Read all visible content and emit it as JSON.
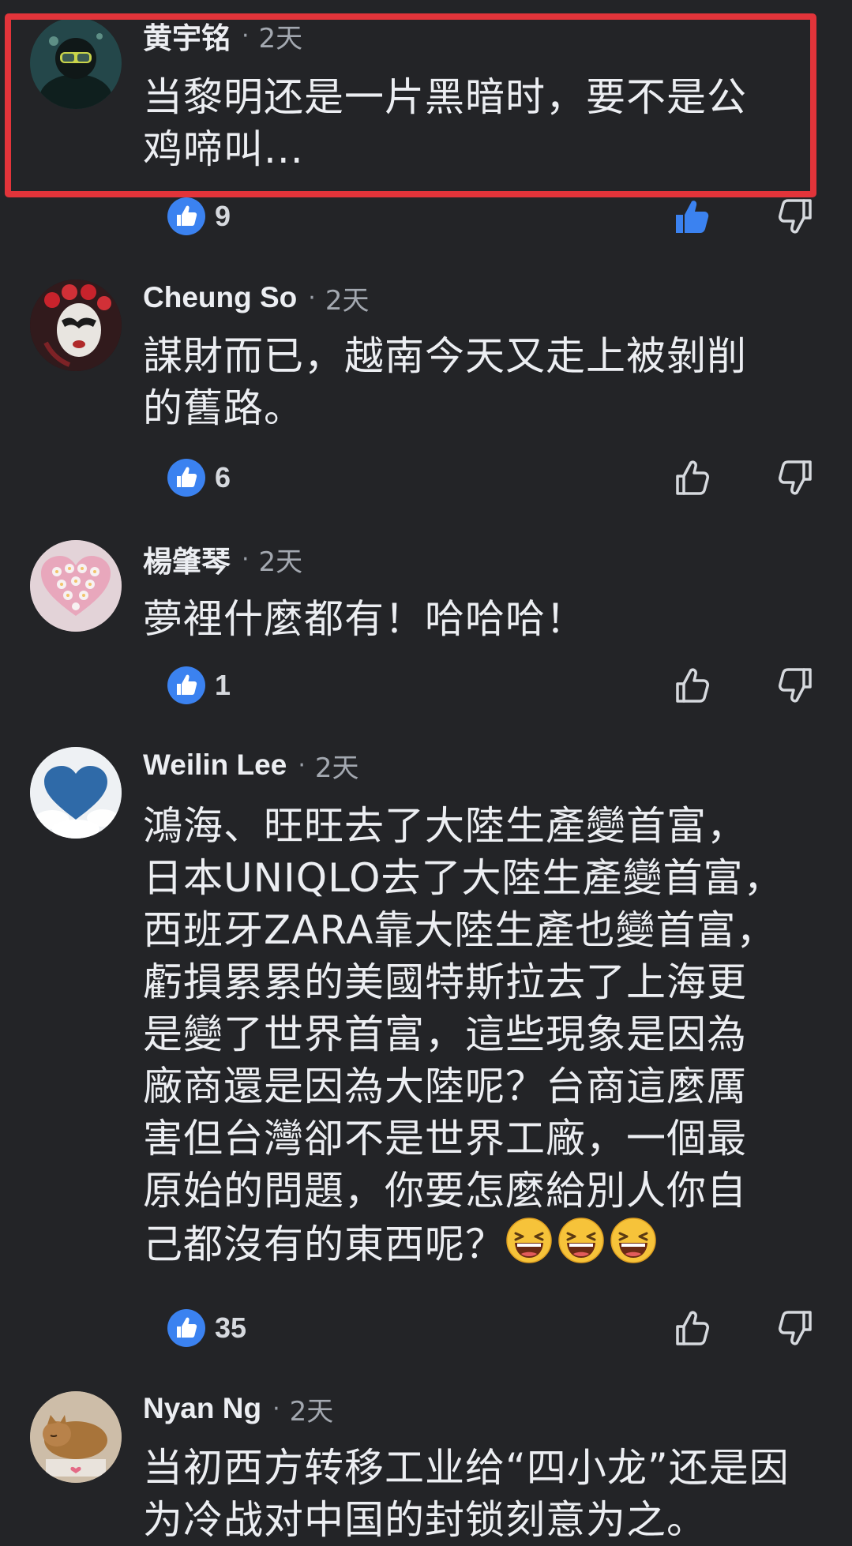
{
  "colors": {
    "background": "#232427",
    "text_primary": "#eceef2",
    "text_secondary": "#a3a8b0",
    "like_badge": "#3b82f0",
    "highlight_border": "#e2343a"
  },
  "comments": [
    {
      "author": "黄宇铭",
      "separator": "·",
      "time": "2天",
      "text": "当黎明还是一片黑暗时，要不是公\n鸡啼叫...",
      "likes": "9",
      "liked_by_viewer": true,
      "avatar_icon": "diver-avatar-icon",
      "highlighted": true
    },
    {
      "author": "Cheung So",
      "separator": "·",
      "time": "2天",
      "text": "謀財而已，越南今天又走上被剝削\n的舊路。",
      "likes": "6",
      "liked_by_viewer": false,
      "avatar_icon": "opera-mask-avatar-icon",
      "highlighted": false
    },
    {
      "author": "楊肇琴",
      "separator": "·",
      "time": "2天",
      "text": "夢裡什麼都有！哈哈哈！",
      "likes": "1",
      "liked_by_viewer": false,
      "avatar_icon": "flower-heart-avatar-icon",
      "highlighted": false
    },
    {
      "author": "Weilin Lee",
      "separator": "·",
      "time": "2天",
      "text": "鴻海、旺旺去了大陸生產變首富，\n日本UNIQLO去了大陸生產變首富，\n西班牙ZARA靠大陸生產也變首富，\n虧損累累的美國特斯拉去了上海更\n是變了世界首富，這些現象是因為\n廠商還是因為大陸呢？台商這麼厲\n害但台灣卻不是世界工廠，一個最\n原始的問題，你要怎麼給別人你自\n己都沒有的東西呢？",
      "emoji_icons": [
        "laughing-emoji-icon",
        "laughing-emoji-icon",
        "laughing-emoji-icon"
      ],
      "likes": "35",
      "liked_by_viewer": false,
      "avatar_icon": "sky-heart-avatar-icon",
      "highlighted": false
    },
    {
      "author": "Nyan Ng",
      "separator": "·",
      "time": "2天",
      "text": "当初西方转移工业给“四小龙”还是因\n为冷战对中国的封锁刻意为之。",
      "avatar_icon": "sleeping-cat-avatar-icon",
      "highlighted": false
    }
  ]
}
